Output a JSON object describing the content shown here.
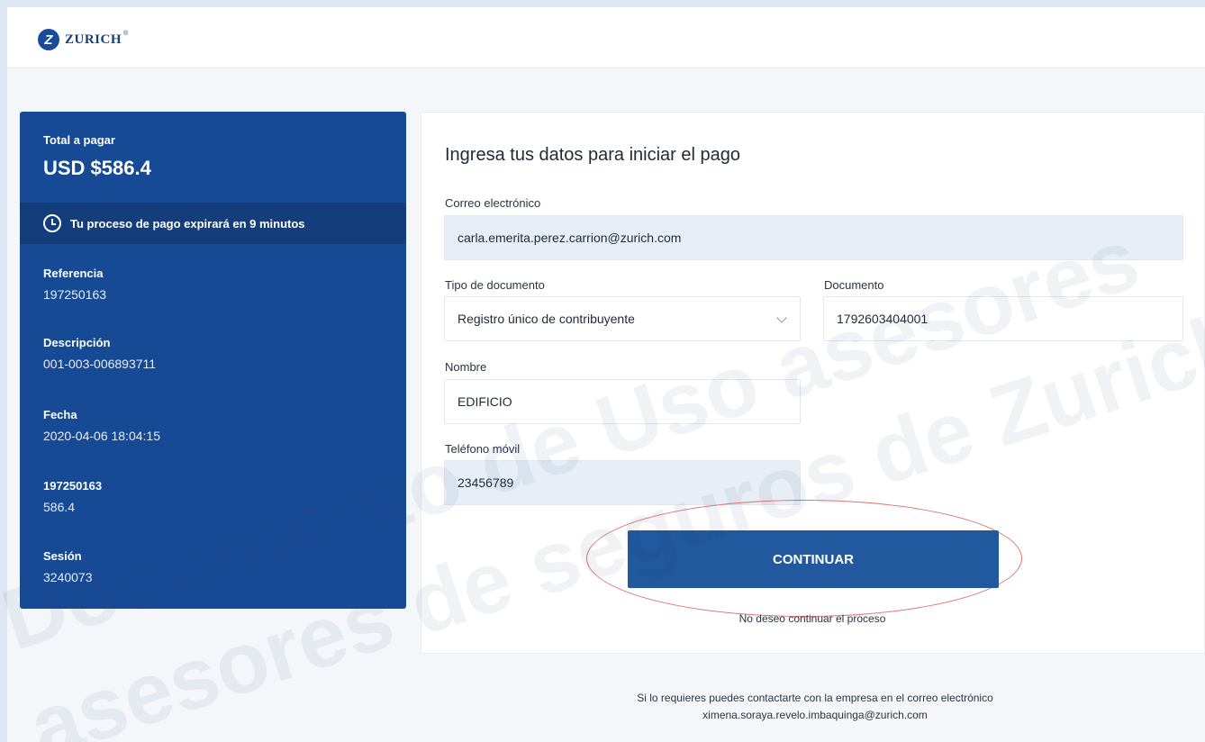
{
  "header": {
    "logo_text": "ZURICH",
    "logo_mark": "Z",
    "logo_reg": "®"
  },
  "summary": {
    "total_label": "Total a pagar",
    "total_value": "USD $586.4",
    "expire_text": "Tu proceso de pago expirará en 9 minutos",
    "items": [
      {
        "label": "Referencia",
        "value": "197250163"
      },
      {
        "label": "Descripción",
        "value": "001-003-006893711"
      },
      {
        "label": "Fecha",
        "value": "2020-04-06 18:04:15"
      },
      {
        "label": "197250163",
        "value": "586.4"
      },
      {
        "label": "Sesión",
        "value": "3240073"
      }
    ]
  },
  "form": {
    "title": "Ingresa tus datos para iniciar el pago",
    "email": {
      "label": "Correo electrónico",
      "value": "carla.emerita.perez.carrion@zurich.com"
    },
    "doc_type": {
      "label": "Tipo de documento",
      "value": "Registro único de contribuyente"
    },
    "document": {
      "label": "Documento",
      "value": "1792603404001"
    },
    "name": {
      "label": "Nombre",
      "value": "EDIFICIO"
    },
    "phone": {
      "label": "Teléfono móvil",
      "value": "23456789"
    },
    "continue_label": "CONTINUAR",
    "cancel_label": "No deseo continuar el proceso"
  },
  "footer": {
    "line1": "Si lo requieres puedes contactarte con la empresa en el correo electrónico",
    "line2": "ximena.soraya.revelo.imbaquinga@zurich.com"
  },
  "watermark": {
    "line1": "Documento de Uso asesores",
    "line2": "asesores de seguros de Zurich"
  },
  "colors": {
    "brand": "#174a94",
    "button": "#22589e",
    "highlight": "#e07070"
  }
}
